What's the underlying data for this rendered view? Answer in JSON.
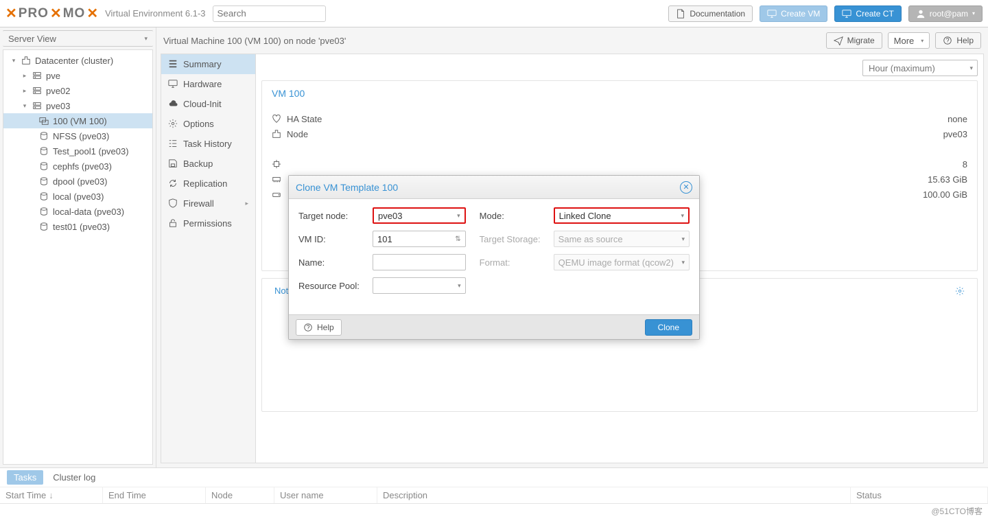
{
  "header": {
    "product_name": "PRO",
    "product_name2": "MO",
    "version_label": "Virtual Environment 6.1-3",
    "search_placeholder": "Search",
    "doc_label": "Documentation",
    "create_vm_label": "Create VM",
    "create_ct_label": "Create CT",
    "user_label": "root@pam"
  },
  "sidebar": {
    "view_label": "Server View",
    "tree": {
      "dc_label": "Datacenter (cluster)",
      "nodes": [
        {
          "label": "pve"
        },
        {
          "label": "pve02"
        },
        {
          "label": "pve03",
          "children": [
            {
              "label": "100 (VM 100)",
              "type": "vm",
              "selected": true
            },
            {
              "label": "NFSS (pve03)",
              "type": "storage"
            },
            {
              "label": "Test_pool1 (pve03)",
              "type": "storage"
            },
            {
              "label": "cephfs (pve03)",
              "type": "storage"
            },
            {
              "label": "dpool (pve03)",
              "type": "storage"
            },
            {
              "label": "local (pve03)",
              "type": "storage"
            },
            {
              "label": "local-data (pve03)",
              "type": "storage"
            },
            {
              "label": "test01 (pve03)",
              "type": "storage"
            }
          ]
        }
      ]
    }
  },
  "content": {
    "title": "Virtual Machine 100 (VM 100) on node 'pve03'",
    "actions": {
      "migrate": "Migrate",
      "more": "More",
      "help": "Help"
    },
    "subnav": [
      {
        "label": "Summary",
        "icon": "list",
        "selected": true
      },
      {
        "label": "Hardware",
        "icon": "monitor"
      },
      {
        "label": "Cloud-Init",
        "icon": "cloud"
      },
      {
        "label": "Options",
        "icon": "gear"
      },
      {
        "label": "Task History",
        "icon": "tasks"
      },
      {
        "label": "Backup",
        "icon": "save"
      },
      {
        "label": "Replication",
        "icon": "sync"
      },
      {
        "label": "Firewall",
        "icon": "shield",
        "chev": true
      },
      {
        "label": "Permissions",
        "icon": "unlock"
      }
    ],
    "time_selector": "Hour (maximum)",
    "summary": {
      "panel_title": "VM 100",
      "ha_label": "HA State",
      "ha_value": "none",
      "node_label": "Node",
      "node_value": "pve03",
      "cpu_value": "8",
      "mem_value": "15.63 GiB",
      "disk_value": "100.00 GiB"
    },
    "notes_title": "Notes"
  },
  "modal": {
    "title": "Clone VM Template 100",
    "left": {
      "target_node_label": "Target node:",
      "target_node_value": "pve03",
      "vmid_label": "VM ID:",
      "vmid_value": "101",
      "name_label": "Name:",
      "name_value": "",
      "pool_label": "Resource Pool:",
      "pool_value": ""
    },
    "right": {
      "mode_label": "Mode:",
      "mode_value": "Linked Clone",
      "storage_label": "Target Storage:",
      "storage_value": "Same as source",
      "format_label": "Format:",
      "format_value": "QEMU image format (qcow2)"
    },
    "help_label": "Help",
    "clone_label": "Clone"
  },
  "bottom": {
    "tasks_label": "Tasks",
    "cluster_log_label": "Cluster log",
    "columns": {
      "start": "Start Time",
      "end": "End Time",
      "node": "Node",
      "user": "User name",
      "desc": "Description",
      "status": "Status"
    }
  },
  "watermark": "@51CTO博客"
}
